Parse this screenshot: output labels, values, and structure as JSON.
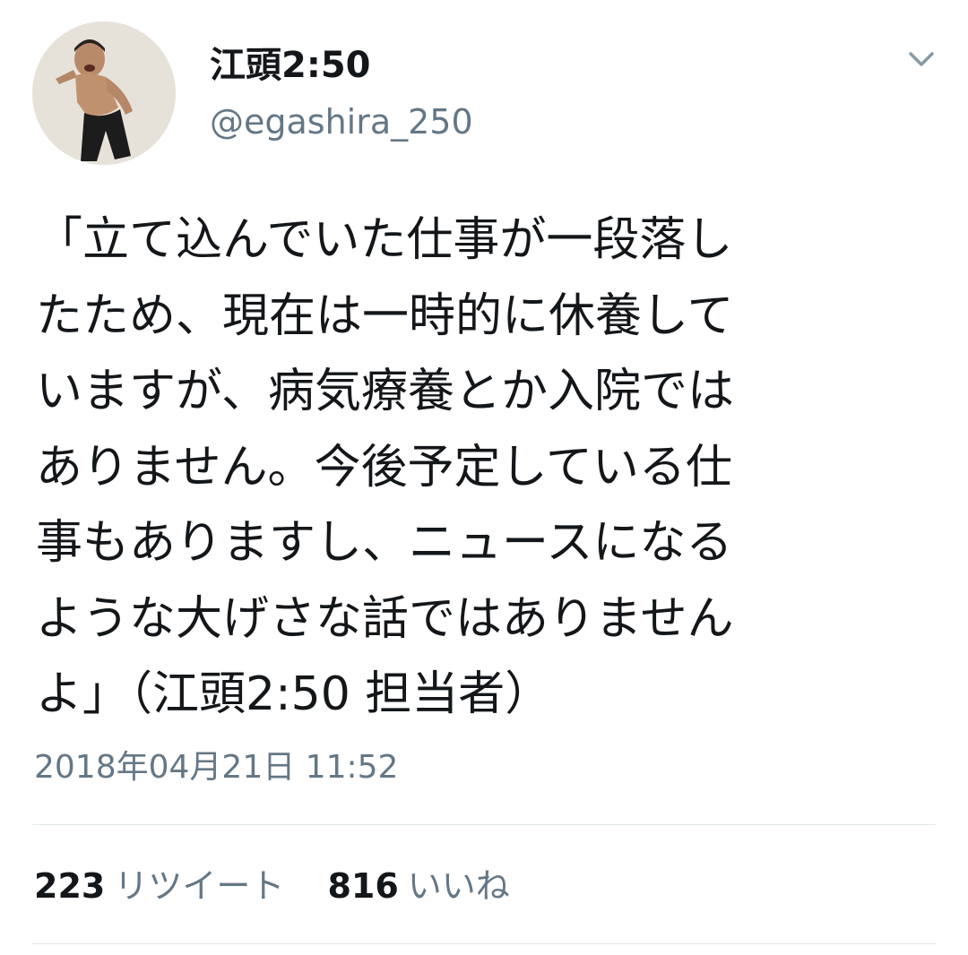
{
  "author": {
    "display_name": "江頭2:50",
    "handle": "@egashira_250",
    "avatar_icon": "profile-photo"
  },
  "menu": {
    "icon": "chevron-down-icon"
  },
  "tweet": {
    "lines": [
      "「立て込んでいた仕事が一段落し",
      "たため、現在は一時的に休養して",
      "いますが、病気療養とか入院では",
      "ありません。今後予定している仕",
      "事もありますし、ニュースになる",
      "ような大げさな話ではありません",
      "よ」（江頭2:50 担当者）"
    ],
    "timestamp": "2018年04月21日 11:52"
  },
  "stats": {
    "retweets": {
      "count": "223",
      "label": "リツイート"
    },
    "likes": {
      "count": "816",
      "label": "いいね"
    }
  },
  "colors": {
    "text": "#14171a",
    "secondary": "#657786",
    "divider": "#e1e8ed",
    "background": "#ffffff"
  }
}
